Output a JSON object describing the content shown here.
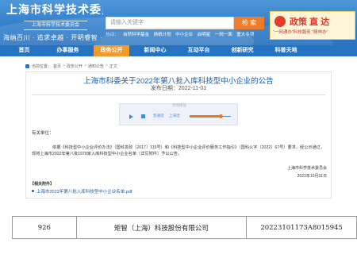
{
  "header": {
    "site_name": "上海市科学技术委员会",
    "site_sub": "上海市科学技术委员会",
    "slogan": "海纳百川 · 追求卓越 · 开明睿智 · 大气谦和",
    "search": {
      "placeholder": "请输入关键字",
      "button_label": "检 索",
      "hot_label": "热词：",
      "hot_words": [
        "自然科学基金",
        "扬帆计划",
        "中小企业",
        "启明星",
        "一网一面",
        "重大专项"
      ]
    },
    "promo": {
      "title": "政策 直 达",
      "subtitle": "“一网通办”科技服务 “随申办”"
    }
  },
  "nav": {
    "items": [
      {
        "label": "首页"
      },
      {
        "label": "办事服务"
      },
      {
        "label": "政务公开"
      },
      {
        "label": "新闻中心"
      },
      {
        "label": "互动平台"
      },
      {
        "label": "创新研究"
      },
      {
        "label": "科普天地"
      }
    ],
    "active_index": 2
  },
  "breadcrumb": {
    "prefix": "当前位置：",
    "items": [
      "首页",
      "政务公开",
      "通知公告",
      "正文"
    ],
    "separator": ">"
  },
  "article": {
    "title": "上海市科委关于2022年第八批入库科技型中小企业的公告",
    "publish_date": "发布日期：2022-11-01",
    "salutation": "有关单位：",
    "body": "依据《科技型中小企业评价办法》（国科发政〔2017〕115号）和《科技型中小企业评价服务工作指引》（国科火字〔2022〕67号）要求，经公示通过，现将上海市2022年第八批1978家入库科技型中小企业名单（详见附件）予以公告。",
    "signer": "上海市科学技术委员会",
    "sign_date": "2022年10月31日"
  },
  "audio_player": {
    "label": "音频播放",
    "voice_label": "普通话",
    "voice_select": "上海话",
    "progress": 0.75
  },
  "attachments": {
    "heading": "【相关附件】",
    "items": [
      {
        "label": "上海市2022年第八批入库科技型中小企业名单.pdf"
      }
    ]
  },
  "excerpt_table": {
    "rows": [
      {
        "index": "926",
        "company": "矩智（上海）科技股份有限公司",
        "code": "20223101173A8015945"
      }
    ]
  },
  "colors": {
    "banner_blue": "#2f7cc9",
    "nav_blue": "#2773c3",
    "nav_active": "#f39a2c",
    "search_button": "#f07d2b",
    "title_blue": "#1a5ea8"
  }
}
